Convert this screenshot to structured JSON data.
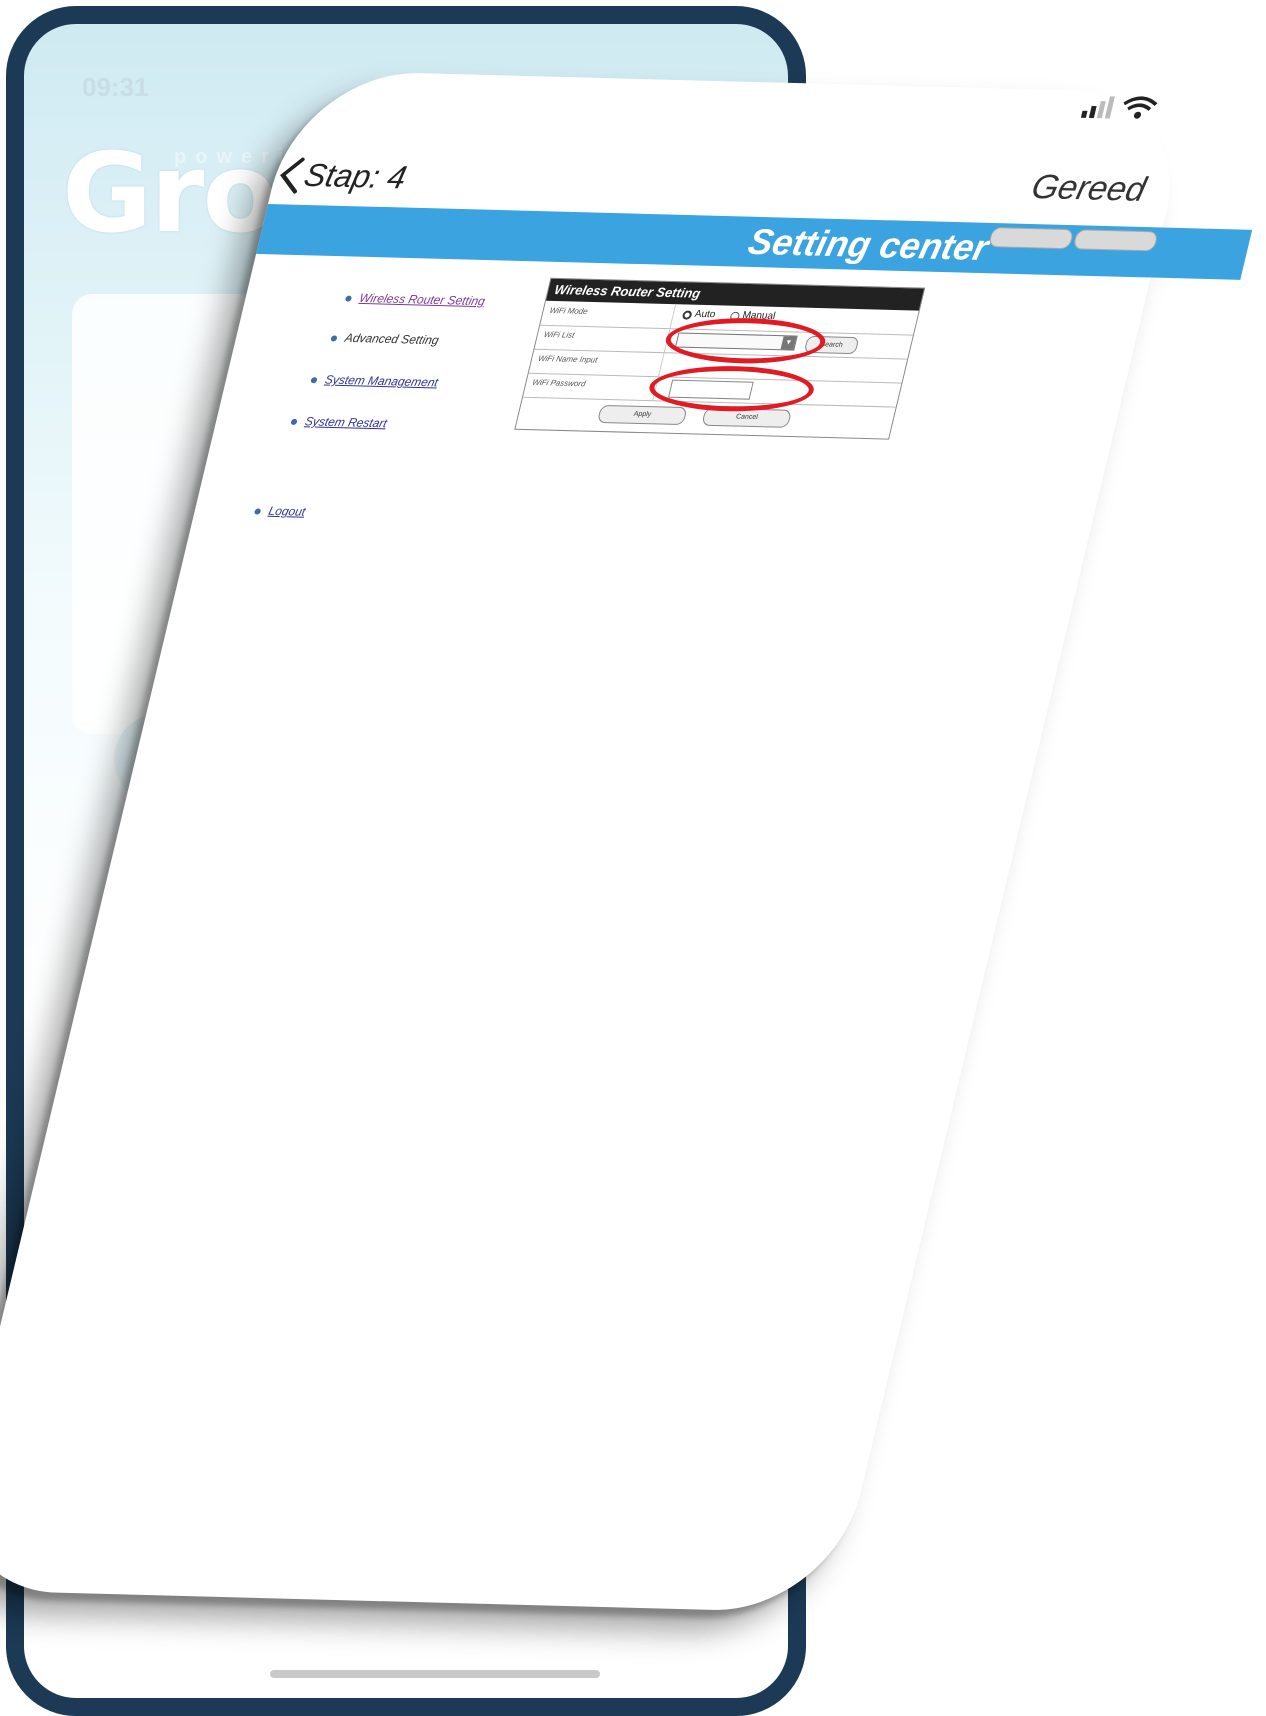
{
  "background_app": {
    "time": "09:31",
    "logo_text": "Growatt",
    "slogan": "powering tomorrow"
  },
  "status_bar": {
    "icons": [
      "signal-icon",
      "wifi-icon"
    ]
  },
  "nav": {
    "back_label": "Stap: 4",
    "done_label": "Gereed"
  },
  "header": {
    "title": "Setting center",
    "languages": [
      "",
      ""
    ]
  },
  "menu": {
    "items": [
      {
        "label": "Wireless Router Setting"
      },
      {
        "label": "Advanced Setting"
      },
      {
        "label": "System Management"
      },
      {
        "label": "System Restart"
      },
      {
        "label": "Logout"
      }
    ]
  },
  "panel": {
    "title": "Wireless Router Setting",
    "rows": {
      "mode_label": "WiFi Mode",
      "mode_auto": "Auto",
      "mode_manual": "Manual",
      "list_label": "WiFi List",
      "list_selected": "",
      "search_label": "Search",
      "name_label": "WiFi Name Input",
      "password_label": "WiFi Password"
    },
    "apply_label": "Apply",
    "cancel_label": "Cancel"
  },
  "colors": {
    "header_blue": "#3aa3e0",
    "highlight_red": "#e01b24",
    "back_frame": "#1c3a55"
  }
}
